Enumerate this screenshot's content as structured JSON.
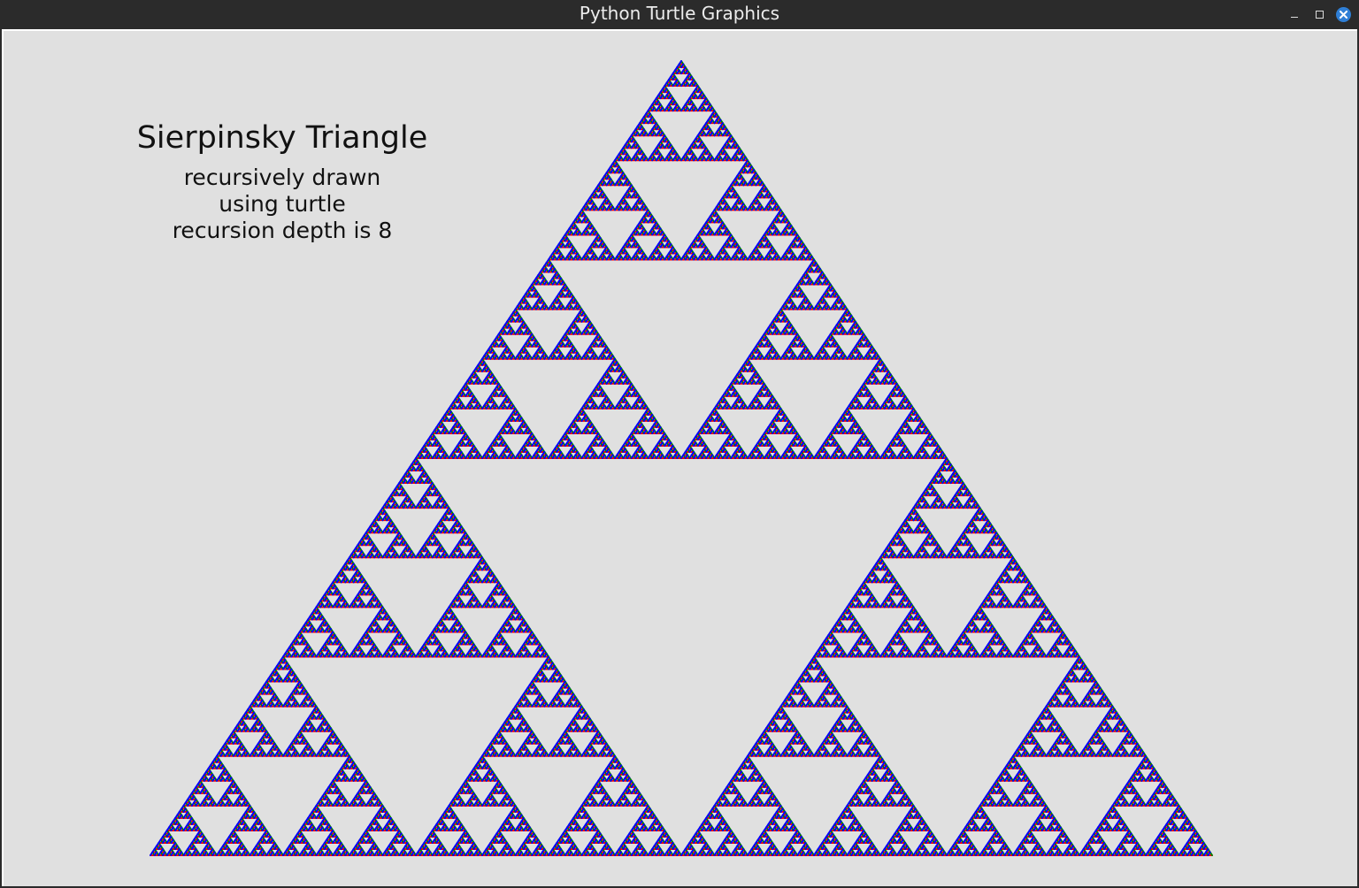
{
  "window": {
    "title": "Python Turtle Graphics",
    "controls": {
      "minimize": "minimize-icon",
      "maximize": "maximize-icon",
      "close": "close-icon"
    },
    "colors": {
      "titlebar": "#2b2b2b",
      "close_button": "#2f7fd6",
      "canvas_background": "#e0e0e0"
    }
  },
  "canvas": {
    "heading": "Sierpinsky Triangle",
    "lines": [
      "recursively drawn",
      "using turtle",
      "recursion depth is 8"
    ],
    "fractal": {
      "recursion_depth": 8,
      "edge_colors": [
        "#ff0000",
        "#008000",
        "#0000ff"
      ]
    }
  }
}
